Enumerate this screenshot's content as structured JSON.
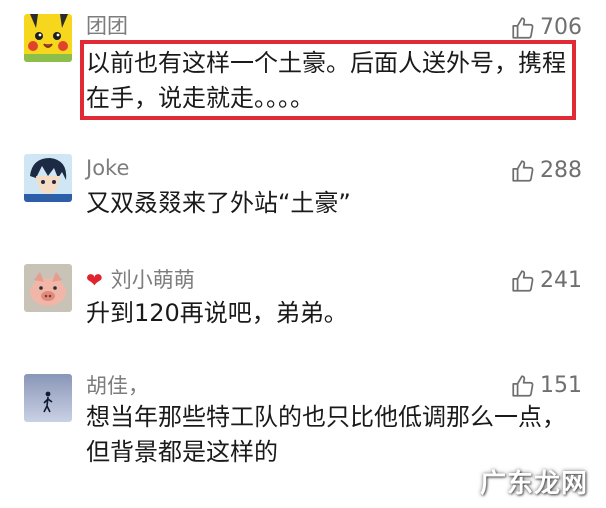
{
  "colors": {
    "highlight_border": "#e02a35",
    "username": "#7d7d7d",
    "body_text": "#1a1a1a",
    "like_count": "#6f6f6f",
    "heart_icon": "#e0242f"
  },
  "comments": [
    {
      "username": "团团",
      "text": "以前也有这样一个土豪。后面人送外号，携程在手，说走就走。。。。",
      "likes": "706",
      "avatar_icon": "pikachu-avatar-icon",
      "highlighted": true
    },
    {
      "username": "Joke",
      "text": "又双叒叕来了外站“土豪”",
      "likes": "288",
      "avatar_icon": "anime-boy-avatar-icon"
    },
    {
      "username": "刘小萌萌",
      "text": "升到120再说吧，弟弟。",
      "likes": "241",
      "avatar_icon": "piglet-avatar-icon",
      "badge_icon": "red-lips-icon"
    },
    {
      "username": "胡佳，",
      "text": "想当年那些特工队的也只比他低调那么一点，但背景都是这样的",
      "likes": "151",
      "avatar_icon": "silhouette-avatar-icon"
    }
  ],
  "watermark": "广东龙网"
}
